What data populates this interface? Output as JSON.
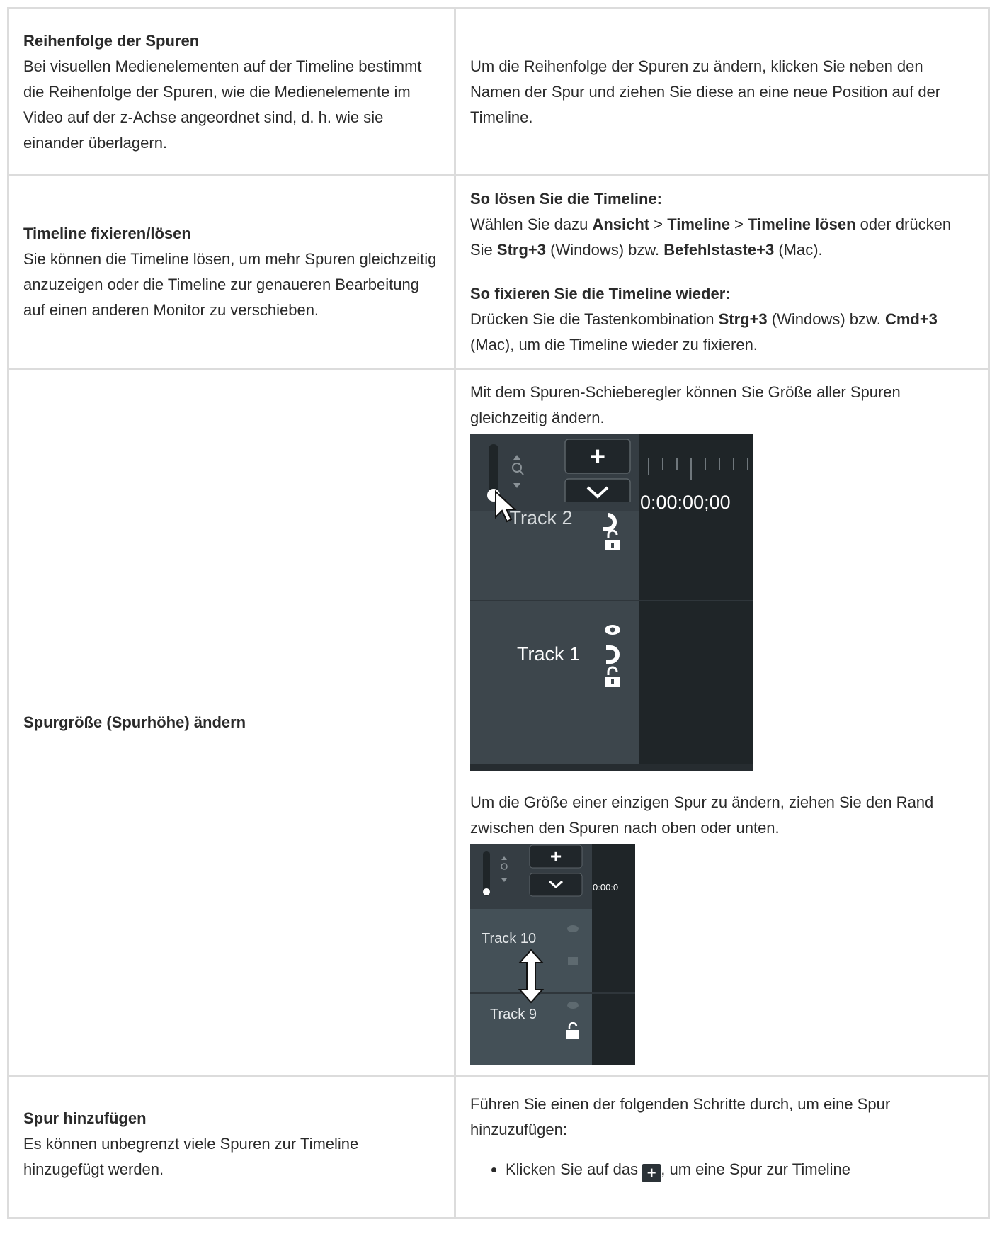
{
  "rows": [
    {
      "title": "Reihenfolge der Spuren",
      "desc": "Bei visuellen Medienelementen auf der Timeline bestimmt die Reihenfolge der Spuren, wie die Medienelemente im Video auf der z-Achse angeordnet sind, d. h. wie sie einander überlagern.",
      "right": "Um die Reihenfolge der Spuren zu ändern, klicken Sie neben den Namen der Spur und ziehen Sie diese an eine neue Position auf der Timeline."
    },
    {
      "title": "Timeline fixieren/lösen",
      "desc": "Sie können die Timeline lösen, um mehr Spuren gleichzeitig anzuzeigen oder die Timeline zur genaueren Bearbeitung auf einen anderen Monitor zu verschieben.",
      "undock_heading": "So lösen Sie die Timeline:",
      "undock_t1": "Wählen Sie dazu ",
      "undock_b1": "Ansicht",
      "undock_t2": " > ",
      "undock_b2": "Timeline",
      "undock_t3": " > ",
      "undock_b3": "Timeline lösen",
      "undock_t4": " oder drücken Sie ",
      "undock_b4": "Strg+3",
      "undock_t5": " (Windows) bzw. ",
      "undock_b5": "Befehlstaste+3",
      "undock_t6": " (Mac).",
      "dock_heading": "So fixieren Sie die Timeline wieder:",
      "dock_t1": "Drücken Sie die Tastenkombination ",
      "dock_b1": "Strg+3",
      "dock_t2": " (Windows) bzw. ",
      "dock_b2": "Cmd+3",
      "dock_t3": " (Mac), um die Timeline wieder zu fixieren."
    },
    {
      "title": "Spurgröße (Spurhöhe) ändern",
      "intro": "Mit dem Spuren-Schieberegler können Sie Größe aller Spuren gleichzeitig ändern.",
      "single": "Um die Größe einer einzigen Spur zu ändern, ziehen Sie den Rand zwischen den Spuren nach oben oder unten."
    },
    {
      "title": "Spur hinzufügen",
      "desc": "Es können unbegrenzt viele Spuren zur Timeline hinzugefügt werden.",
      "intro": "Führen Sie einen der folgenden Schritte durch, um eine Spur hinzuzufügen:",
      "bullet1_a": "Klicken Sie auf das ",
      "bullet1_b": ", um eine Spur zur Timeline"
    }
  ],
  "screenshot1": {
    "timecode": "0:00:00;00",
    "track_top": "Track 2",
    "track_bottom": "Track 1",
    "plus": "+"
  },
  "screenshot2": {
    "timecode": "0:00:0",
    "track_top": "Track 10",
    "track_bottom": "Track 9",
    "plus": "+"
  },
  "colors": {
    "border": "#dcdcdc",
    "panel_dark": "#22292d",
    "panel_mid": "#353d43",
    "track_bg": "#404a50"
  }
}
